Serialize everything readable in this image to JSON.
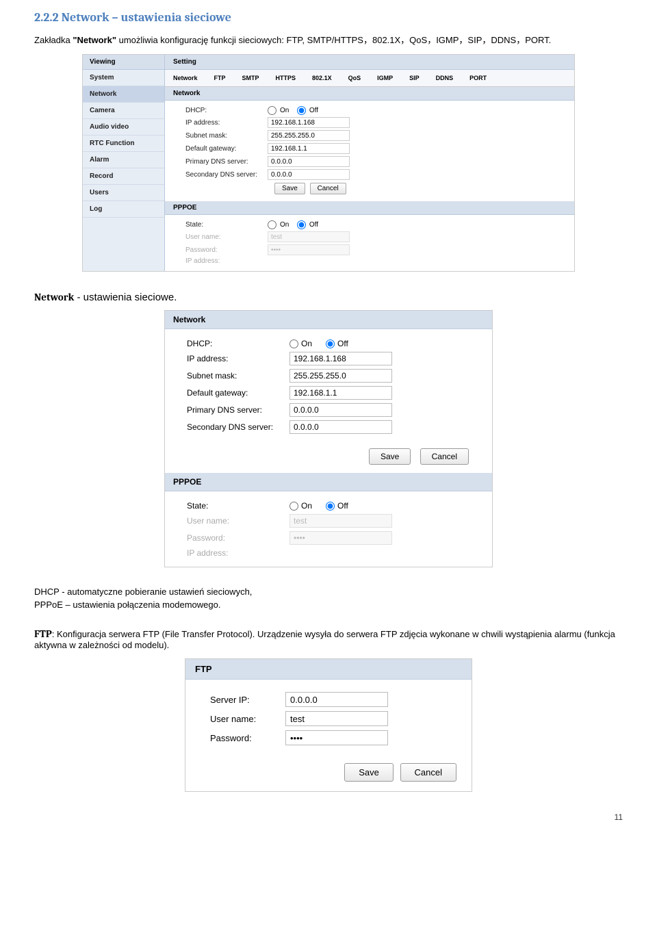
{
  "heading": "2.2.2  Network – ustawienia sieciowe",
  "intro_prefix": "Zakładka ",
  "intro_bold": "\"Network\"",
  "intro_suffix": " umożliwia konfigurację funkcji sieciowych: FTP, SMTP/HTTPS，802.1X，QoS，IGMP，SIP，DDNS，PORT.",
  "shot1": {
    "viewing": "Viewing",
    "nav": [
      "System",
      "Network",
      "Camera",
      "Audio video",
      "RTC Function",
      "Alarm",
      "Record",
      "Users",
      "Log"
    ],
    "setting": "Setting",
    "tabs": [
      "Network",
      "FTP",
      "SMTP",
      "HTTPS",
      "802.1X",
      "QoS",
      "IGMP",
      "SIP",
      "DDNS",
      "PORT"
    ],
    "subhead_network": "Network",
    "dhcp_label": "DHCP:",
    "on": "On",
    "off": "Off",
    "ip_label": "IP address:",
    "ip_val": "192.168.1.168",
    "subnet_label": "Subnet mask:",
    "subnet_val": "255.255.255.0",
    "gw_label": "Default gateway:",
    "gw_val": "192.168.1.1",
    "dns1_label": "Primary DNS server:",
    "dns1_val": "0.0.0.0",
    "dns2_label": "Secondary DNS server:",
    "dns2_val": "0.0.0.0",
    "save": "Save",
    "cancel": "Cancel",
    "pppoe_head": "PPPOE",
    "state_label": "State:",
    "user_label": "User name:",
    "user_val": "test",
    "pass_label": "Password:",
    "pass_val": "••••",
    "ipaddr_label": "IP address:"
  },
  "network_settings_lead": "Network",
  "network_settings_rest": " -  ustawienia sieciowe.",
  "shot2": {
    "head_network": "Network",
    "dhcp_label": "DHCP:",
    "on": "On",
    "off": "Off",
    "ip_label": "IP address:",
    "ip_val": "192.168.1.168",
    "subnet_label": "Subnet mask:",
    "subnet_val": "255.255.255.0",
    "gw_label": "Default gateway:",
    "gw_val": "192.168.1.1",
    "dns1_label": "Primary DNS server:",
    "dns1_val": "0.0.0.0",
    "dns2_label": "Secondary DNS server:",
    "dns2_val": "0.0.0.0",
    "save": "Save",
    "cancel": "Cancel",
    "pppoe_head": "PPPOE",
    "state_label": "State:",
    "user_label": "User name:",
    "user_val": "test",
    "pass_label": "Password:",
    "pass_val": "••••",
    "ipaddr_label": "IP address:"
  },
  "dhcp_desc1": "DHCP - automatyczne pobieranie ustawień sieciowych,",
  "dhcp_desc2": "PPPoE – ustawienia połączenia modemowego.",
  "ftp_lead": "FTP",
  "ftp_rest": ":  Konfiguracja serwera FTP (File Transfer Protocol). Urządzenie wysyła do serwera FTP zdjęcia wykonane w chwili wystąpienia alarmu (funkcja aktywna w zależności od modelu).",
  "shot3": {
    "head": "FTP",
    "server_label": "Server IP:",
    "server_val": "0.0.0.0",
    "user_label": "User name:",
    "user_val": "test",
    "pass_label": "Password:",
    "pass_val": "••••",
    "save": "Save",
    "cancel": "Cancel"
  },
  "page_number": "11"
}
